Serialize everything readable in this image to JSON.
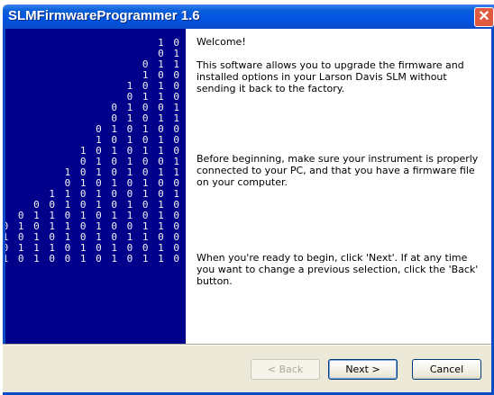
{
  "window": {
    "title": "SLMFirmwareProgrammer 1.6",
    "close_symbol": "✕"
  },
  "graphic": {
    "binary_rows": [
      "1 0",
      "0 1",
      "0 1 1",
      "1 0 0",
      "1 0 1 0",
      "0 1 1 0",
      "0 1 0 0 1",
      "0 1 0 1 1",
      "0 1 0 1 0 0",
      "1 0 1 0 1 0",
      "1 0 1 0 1 1 0",
      "0 1 0 1 0 0 1",
      "1 0 1 0 1 0 1 1",
      "0 1 0 1 0 1 0 0",
      "1 1 0 1 0 0 1 0 1",
      "0 0 1 0 1 0 1 0 1 0",
      "0 1 1 0 1 0 1 1 0 1 0",
      "0 1 0 1 1 0 1 0 0 1 1 0",
      "0 1 0 1 0 1 0 1 0 1 1 0 0",
      "1 0 0 1 1 1 0 1 0 1 0 0 1 0",
      "1 0 1 1 0 1 0 0 1 0 1 0 1 1 0"
    ]
  },
  "content": {
    "heading": "Welcome!",
    "para1": "This software allows you to upgrade the firmware and installed options in your Larson Davis SLM without sending it back to the factory.",
    "para2": "Before beginning, make sure your instrument is properly connected to your PC, and that you have a firmware file on your computer.",
    "para3": "When you're ready to begin, click 'Next'.  If at any time you want to change a previous selection, click the 'Back' button."
  },
  "buttons": {
    "back": "< Back",
    "next": "Next >",
    "cancel": "Cancel"
  }
}
